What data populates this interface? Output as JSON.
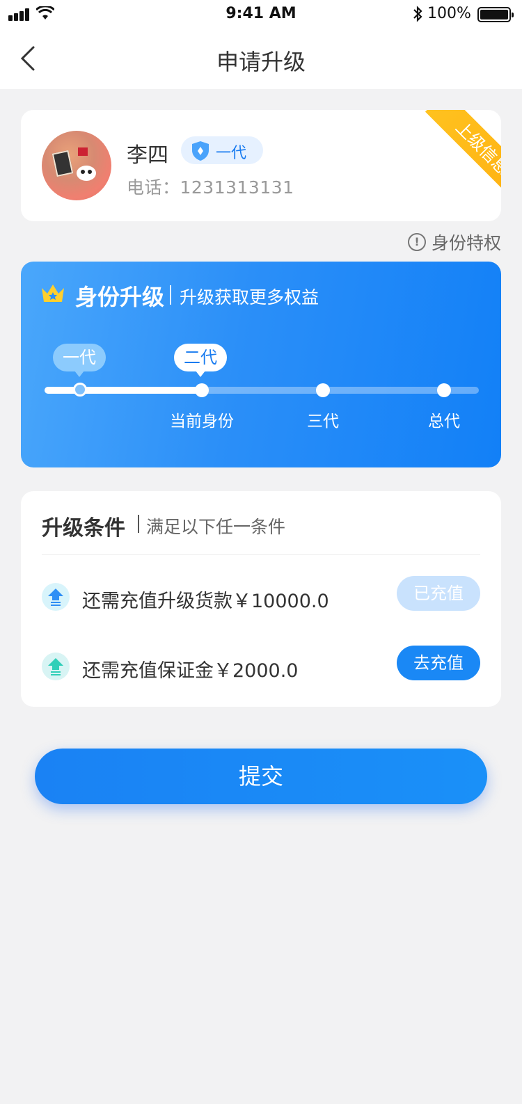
{
  "status_bar": {
    "time": "9:41 AM",
    "battery": "100%"
  },
  "nav": {
    "title": "申请升级",
    "back_icon": "chevron-left-icon"
  },
  "profile": {
    "name": "李四",
    "level": "一代",
    "phone": "电话：1231313131",
    "ribbon": "上级信息"
  },
  "privilege_link": "身份特权",
  "upgrade": {
    "title": "身份升级",
    "subtitle": "升级获取更多权益",
    "progress": {
      "current_index": 1,
      "nodes": [
        {
          "bubble": "一代",
          "label": ""
        },
        {
          "bubble": "二代",
          "label": "当前身份"
        },
        {
          "bubble": "",
          "label": "三代"
        },
        {
          "bubble": "",
          "label": "总代"
        }
      ]
    }
  },
  "conditions": {
    "title": "升级条件",
    "subtitle": "满足以下任一条件",
    "items": [
      {
        "text": "还需充值升级货款￥10000.0",
        "button": "已充值",
        "status": "done",
        "icon": "upgrade-arrow-icon",
        "icon_color": "#2f8ff5",
        "icon_bg": "#d8f4fb"
      },
      {
        "text": "还需充值保证金￥2000.0",
        "button": "去充值",
        "status": "todo",
        "icon": "deposit-arrow-icon",
        "icon_color": "#2fcfb8",
        "icon_bg": "#d8f4f4"
      }
    ]
  },
  "submit": {
    "label": "提交"
  },
  "colors": {
    "primary": "#1a88f5",
    "ribbon": "#ffb716",
    "background": "#f2f2f3"
  }
}
